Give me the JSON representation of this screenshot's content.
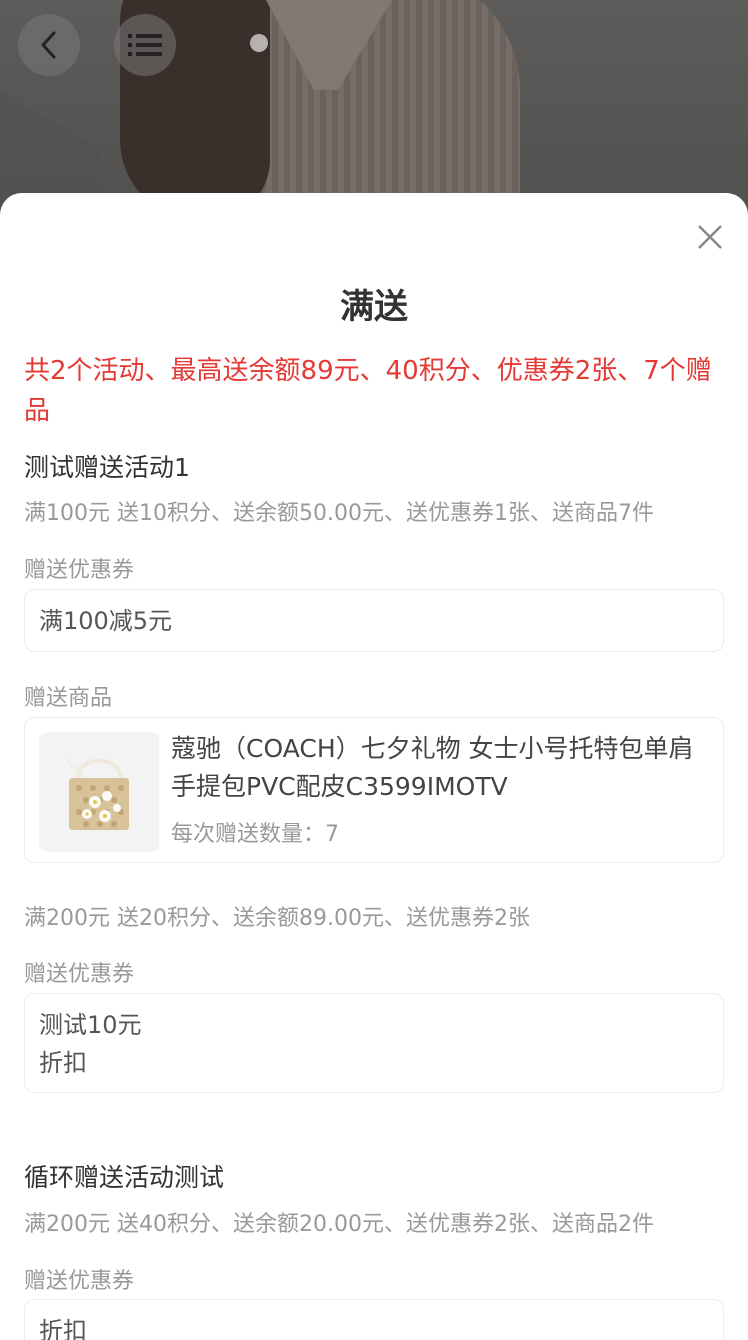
{
  "nav": {
    "back_icon": "chevron-left-icon",
    "menu_icon": "list-icon"
  },
  "sheet": {
    "title": "满送",
    "close_icon": "close-icon",
    "summary": "共2个活动、最高送余额89元、40积分、优惠券2张、7个赠品"
  },
  "activities": [
    {
      "name": "测试赠送活动1",
      "tiers": [
        {
          "rule": "满100元 送10积分、送余额50.00元、送优惠券1张、送商品7件",
          "coupon_label": "赠送优惠券",
          "coupons": [
            "满100减5元"
          ],
          "product_label": "赠送商品",
          "product": {
            "name": "蔻驰（COACH）七夕礼物 女士小号托特包单肩手提包PVC配皮C3599IMOTV",
            "qty": "每次赠送数量：7"
          }
        },
        {
          "rule": "满200元 送20积分、送余额89.00元、送优惠券2张",
          "coupon_label": "赠送优惠券",
          "coupons": [
            "测试10元",
            "折扣"
          ]
        }
      ]
    },
    {
      "name": "循环赠送活动测试",
      "tiers": [
        {
          "rule": "满200元 送40积分、送余额20.00元、送优惠券2张、送商品2件",
          "coupon_label": "赠送优惠券",
          "coupons": [
            "折扣"
          ]
        }
      ]
    }
  ]
}
